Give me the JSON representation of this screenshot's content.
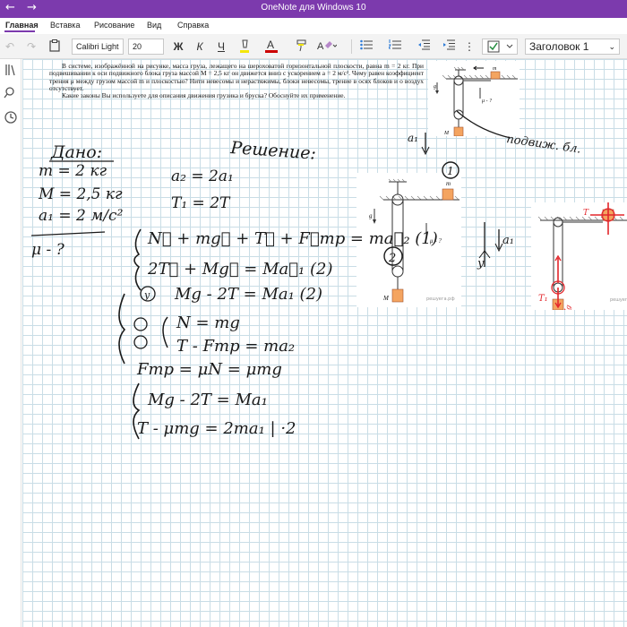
{
  "window": {
    "title": "OneNote для Windows 10",
    "back_icon": "arrow-left-icon",
    "forward_icon": "arrow-right-icon"
  },
  "tabs": [
    {
      "label": "Главная",
      "active": true
    },
    {
      "label": "Вставка",
      "active": false
    },
    {
      "label": "Рисование",
      "active": false
    },
    {
      "label": "Вид",
      "active": false
    },
    {
      "label": "Справка",
      "active": false
    }
  ],
  "ribbon": {
    "font_name": "Calibri Light",
    "font_size": "20",
    "bold": "Ж",
    "italic": "К",
    "underline": "Ч",
    "font_color_letter": "A",
    "style_name": "Заголовок 1",
    "accent": "#7c3aad"
  },
  "problem": {
    "paragraph1": "В системе, изображённой на рисунке, масса груза, лежащего на шероховатой горизонтальной плоскости, равна m = 2 кг. При подвешивании к оси подвижного блока груза массой M = 2,5 кг он движется вниз с ускорением a = 2 м/с². Чему равен коэффициент трения μ между грузом массой m и плоскостью? Нити невесомы и нерастяжимы, блоки невесомы, трение в осях блоков и о воздух отсутствует.",
    "paragraph2": "Какие законы Вы используете для описания движения грузика и бруска? Обоснуйте их применение."
  },
  "figure": {
    "label_g": "g",
    "label_m": "m",
    "label_M": "M",
    "label_mu": "μ - ?",
    "watermark": "решуега.рф"
  },
  "notes": {
    "dano_title": "Дано:",
    "given_m": "m = 2 кг",
    "given_M": "M = 2,5 кг",
    "given_a": "a₁ = 2 м/с²",
    "find": "μ - ?",
    "reshenie_title": "Решение:",
    "a2": "a₂ = 2a₁",
    "T1": "T₁ = 2T",
    "eq1": "N⃗ + mg⃗ + T⃗ + F⃗тр = ma⃗₂  (1)",
    "eq2": "2T⃗ + Mg⃗ = Ma⃗₁  (2)",
    "proj_y": "Mg - 2T = Ma₁  (2)",
    "proj_y2": "N = mg",
    "proj_x": "T - Fтр = ma₂",
    "friction": "Fтр = μN = μmg",
    "sys1": "Mg - 2T = Ma₁",
    "sys2": "T - μmg = 2ma₁  | ·2",
    "note_block": "подвиж. бл.",
    "circle1": "1",
    "circle2": "2",
    "a1_label": "a₁",
    "y_label": "y",
    "T_red": "T",
    "T1_red": "T₁",
    "Mg_red": "Mg"
  },
  "sidebar": [
    {
      "name": "notebooks-icon"
    },
    {
      "name": "search-icon"
    },
    {
      "name": "recent-icon"
    }
  ]
}
